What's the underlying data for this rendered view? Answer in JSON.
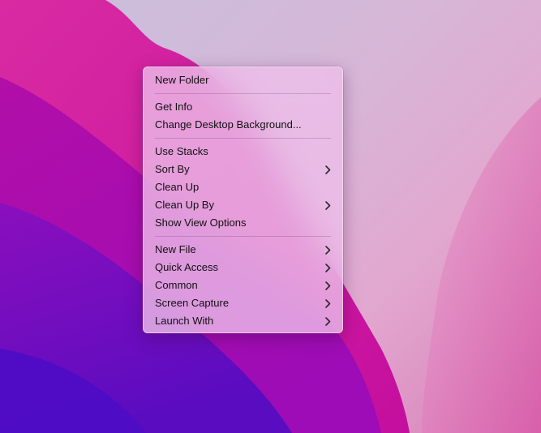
{
  "context_menu": {
    "groups": [
      {
        "items": [
          {
            "label": "New Folder",
            "submenu": false
          }
        ]
      },
      {
        "items": [
          {
            "label": "Get Info",
            "submenu": false
          },
          {
            "label": "Change Desktop Background...",
            "submenu": false
          }
        ]
      },
      {
        "items": [
          {
            "label": "Use Stacks",
            "submenu": false
          },
          {
            "label": "Sort By",
            "submenu": true
          },
          {
            "label": "Clean Up",
            "submenu": false
          },
          {
            "label": "Clean Up By",
            "submenu": true
          },
          {
            "label": "Show View Options",
            "submenu": false
          }
        ]
      },
      {
        "items": [
          {
            "label": "New File",
            "submenu": true
          },
          {
            "label": "Quick Access",
            "submenu": true
          },
          {
            "label": "Common",
            "submenu": true
          },
          {
            "label": "Screen Capture",
            "submenu": true
          },
          {
            "label": "Launch With",
            "submenu": true
          }
        ]
      }
    ]
  },
  "icons": {
    "submenu": "chevron-right-icon"
  },
  "colors": {
    "menu_text": "#111111",
    "wallpaper_magenta": "#c10fa0",
    "wallpaper_purple": "#6a0fc0"
  }
}
